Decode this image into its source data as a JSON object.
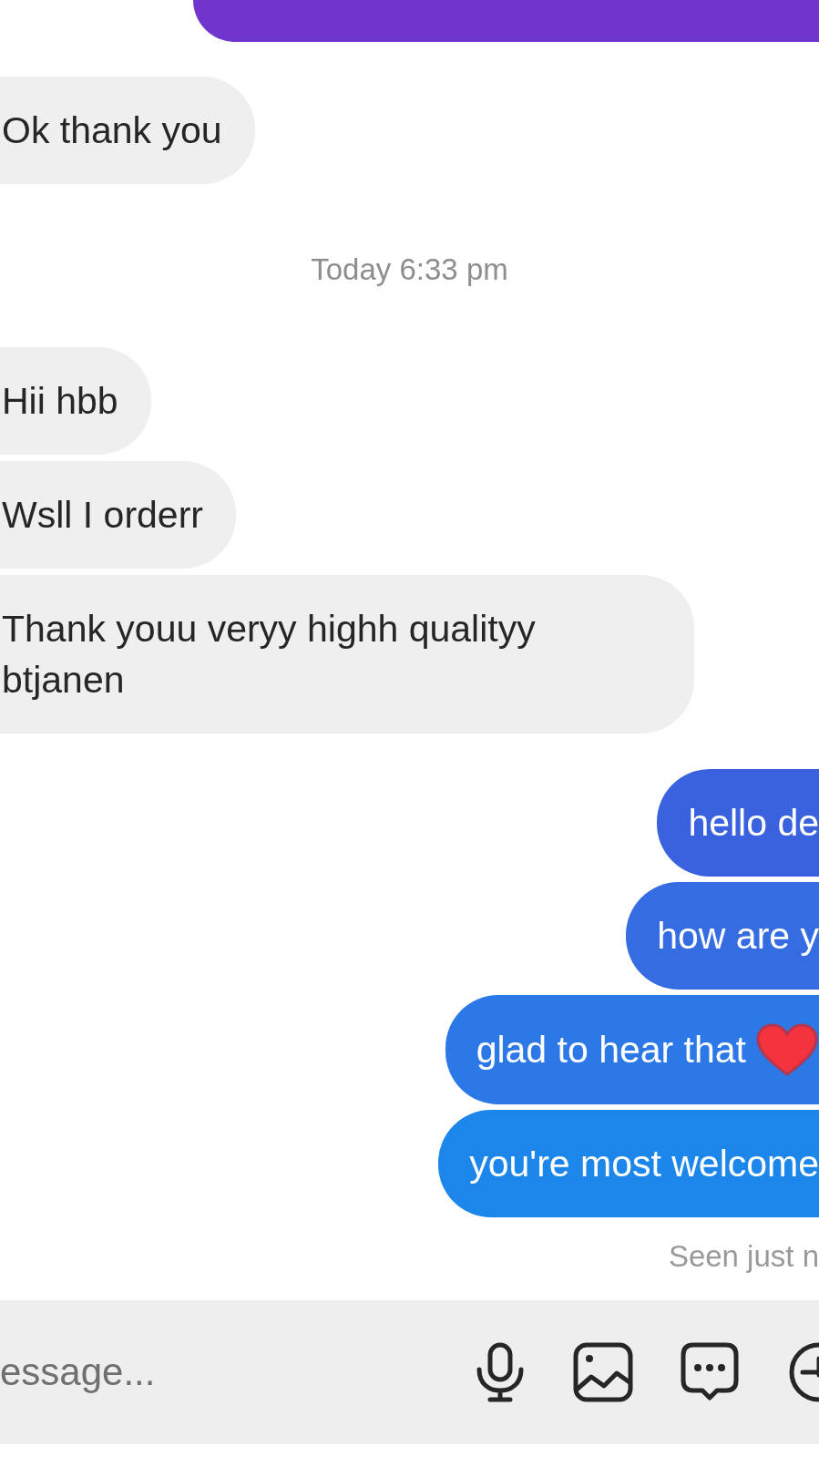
{
  "messages": [
    {
      "kind": "received",
      "text": "Ok thank you"
    },
    {
      "kind": "timestamp",
      "text": "Today 6:33 pm"
    },
    {
      "kind": "received",
      "text": "Hii hbb"
    },
    {
      "kind": "received",
      "text": "Wsll I orderr"
    },
    {
      "kind": "received",
      "text": "Thank youu veryy highh qualityy\nbtjanen"
    },
    {
      "kind": "sent",
      "text": "hello de"
    },
    {
      "kind": "sent",
      "text": "how are y"
    },
    {
      "kind": "sent",
      "text": "glad to hear that",
      "heart": true
    },
    {
      "kind": "sent",
      "text": "you're most welcome"
    }
  ],
  "seen": "Seen just n",
  "composer": {
    "placeholder": "essage..."
  }
}
